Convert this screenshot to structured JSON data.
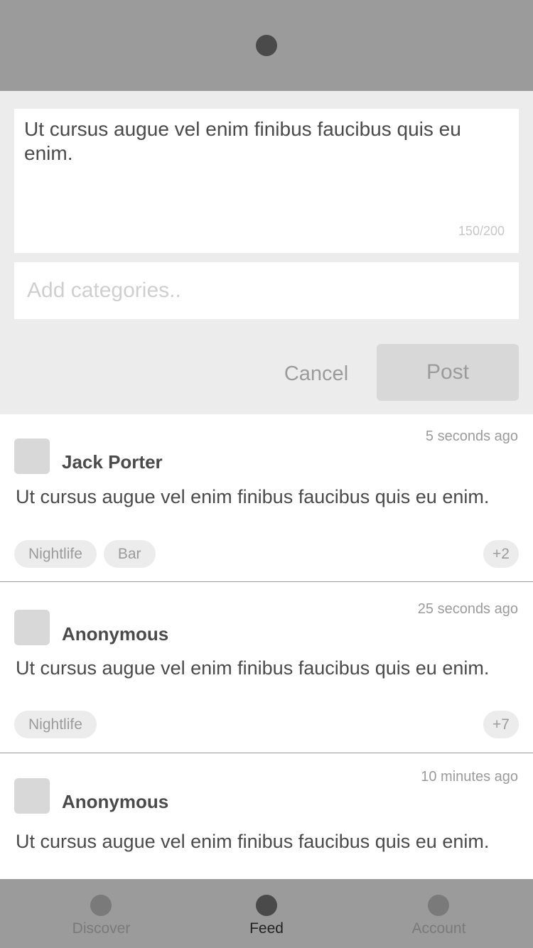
{
  "header": {
    "logo_icon": "circle-logo-icon"
  },
  "composer": {
    "text": "Ut cursus augue vel enim finibus faucibus quis eu enim.",
    "char_count": "150/200",
    "categories_placeholder": "Add categories..",
    "cancel_label": "Cancel",
    "post_label": "Post"
  },
  "feed": {
    "posts": [
      {
        "author": "Jack Porter",
        "timestamp": "5 seconds ago",
        "body": "Ut cursus augue vel enim finibus faucibus quis eu enim.",
        "tags": [
          "Nightlife",
          "Bar"
        ],
        "more": "+2"
      },
      {
        "author": "Anonymous",
        "timestamp": "25 seconds ago",
        "body": "Ut cursus augue vel enim finibus faucibus quis eu enim.",
        "tags": [
          "Nightlife"
        ],
        "more": "+7"
      },
      {
        "author": "Anonymous",
        "timestamp": "10 minutes ago",
        "body": "Ut cursus augue vel enim finibus faucibus quis eu enim."
      }
    ]
  },
  "tabs": [
    {
      "label": "Discover",
      "icon": "discover-icon",
      "active": false
    },
    {
      "label": "Feed",
      "icon": "feed-icon",
      "active": true
    },
    {
      "label": "Account",
      "icon": "account-icon",
      "active": false
    }
  ],
  "colors": {
    "header_bg": "#9b9b9b",
    "composer_bg": "#ececec",
    "chip_bg": "#ececec",
    "text_dark": "#4a4a4a",
    "text_muted": "#9b9b9b"
  }
}
